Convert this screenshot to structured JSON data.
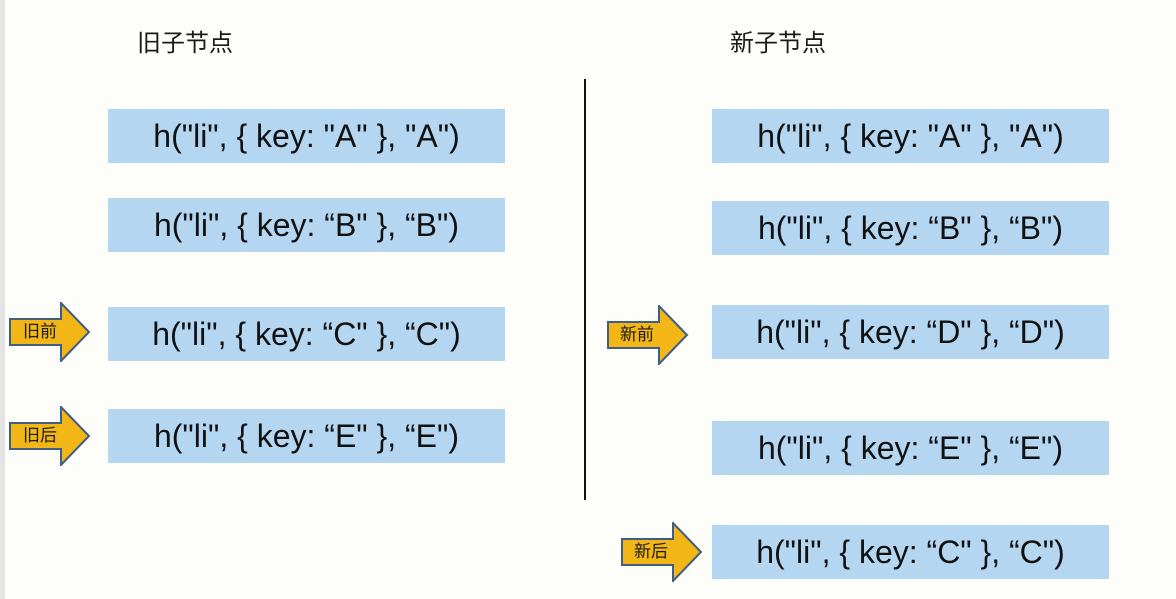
{
  "headings": {
    "old": "旧子节点",
    "new": "新子节点"
  },
  "old_nodes": [
    "h(\"li\", { key: \"A\" }, \"A\")",
    "h(\"li\", { key: “B\" }, “B\")",
    "h(\"li\", { key: “C\" }, “C\")",
    "h(\"li\", { key: “E\" }, “E\")"
  ],
  "new_nodes": [
    "h(\"li\", { key: \"A\" }, \"A\")",
    "h(\"li\", { key: “B\" }, “B\")",
    "h(\"li\", { key: “D\" }, “D\")",
    "h(\"li\", { key: “E\" }, “E\")",
    "h(\"li\", { key: “C\" }, “C\")"
  ],
  "pointers": {
    "old_start": "旧前",
    "old_end": "旧后",
    "new_start": "新前",
    "new_end": "新后"
  },
  "colors": {
    "node_fill": "#b4d6f1",
    "arrow_fill": "#f2b616",
    "arrow_stroke": "#3f5e86"
  }
}
